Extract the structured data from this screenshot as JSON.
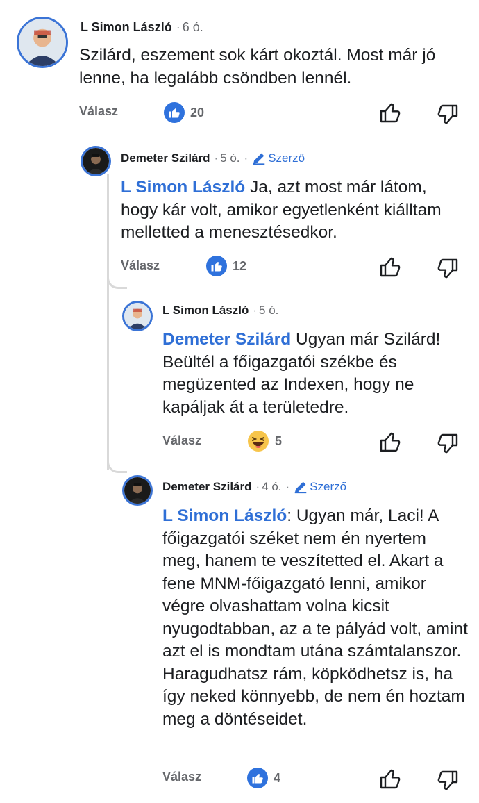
{
  "comments": [
    {
      "author": "L Simon László",
      "time": "6 ó.",
      "is_author": false,
      "mention": "",
      "text": "Szilárd, eszement sok kárt okoztál. Most már jó lenne, ha legalább csöndben lennél.",
      "reply_label": "Válasz",
      "reaction": "like",
      "reaction_count": "20"
    },
    {
      "author": "Demeter Szilárd",
      "time": "5 ó.",
      "is_author": true,
      "author_badge": "Szerző",
      "mention": "L Simon László",
      "text": " Ja, azt most már látom, hogy kár volt, amikor egyetlenként kiálltam melletted a menesztésedkor.",
      "reply_label": "Válasz",
      "reaction": "like",
      "reaction_count": "12"
    },
    {
      "author": "L Simon László",
      "time": "5 ó.",
      "is_author": false,
      "mention": "Demeter Szilárd",
      "text": " Ugyan már Szilárd! Beültél a főigazgatói székbe és megüzented az Indexen, hogy ne kapáljak át  a területedre.",
      "reply_label": "Válasz",
      "reaction": "haha",
      "reaction_count": "5"
    },
    {
      "author": "Demeter Szilárd",
      "time": "4 ó.",
      "is_author": true,
      "author_badge": "Szerző",
      "mention": "L Simon László",
      "text": ": Ugyan már, Laci! A főigazgatói széket nem én nyertem meg, hanem te veszítetted el. Akart a fene MNM-főigazgató lenni, amikor végre olvashattam volna kicsit nyugodtabban, az a te pályád volt, amint azt el is mondtam utána számtalanszor. Haragudhatsz rám, köpködhetsz is, ha így neked könnyebb, de nem én hoztam meg a döntéseidet.",
      "reply_label": "Válasz",
      "reaction": "like",
      "reaction_count": "4"
    }
  ],
  "colors": {
    "accent": "#2f6fd6",
    "thread_line": "#d9d9d9",
    "avatar_ring": "#3b74d6"
  }
}
